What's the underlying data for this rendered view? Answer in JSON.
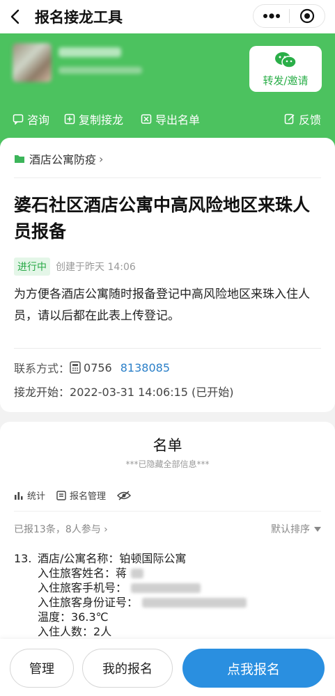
{
  "nav": {
    "title": "报名接龙工具"
  },
  "header": {
    "share_label": "转发/邀请",
    "actions": {
      "consult": "咨询",
      "copy": "复制接龙",
      "export": "导出名单",
      "feedback": "反馈"
    }
  },
  "activity": {
    "category": "酒店公寓防疫",
    "title": "婆石社区酒店公寓中高风险地区来珠人员报备",
    "status": "进行中",
    "created": "创建于昨天 14:06",
    "description": "为方便各酒店公寓随时报备登记中高风险地区来珠入住人员，请以后都在此表上传登记。",
    "contact_label": "联系方式：",
    "phone_area": "0756",
    "phone_number": "8138085",
    "start_label": "接龙开始：",
    "start_value": "2022-03-31 14:06:15 (已开始)"
  },
  "list": {
    "heading": "名单",
    "hidden_note": "***已隐藏全部信息***",
    "tools": {
      "stats": "统计",
      "manage": "报名管理"
    },
    "summary": "已报13条，8人参与",
    "sort": "默认排序",
    "entry": {
      "index": "13.",
      "hotel_label": "酒店/公寓名称：",
      "hotel_value": "铂顿国际公寓",
      "guest_name_label": "入住旅客姓名：",
      "guest_name_value": "蒋",
      "guest_phone_label": "入住旅客手机号：",
      "guest_id_label": "入住旅客身份证号：",
      "temp_label": "温度：",
      "temp_value": "36.3℃",
      "count_label": "入住人数：",
      "count_value": "2人"
    }
  },
  "bottom": {
    "manage": "管理",
    "mine": "我的报名",
    "join": "点我报名"
  },
  "colors": {
    "green": "#4cc25f",
    "blue": "#2a8fe0",
    "status_green": "#26a845"
  }
}
